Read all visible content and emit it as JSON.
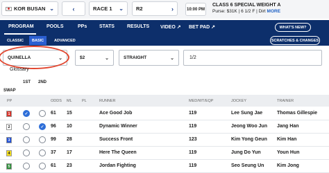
{
  "header": {
    "track": "KOR BUSAN",
    "race": "RACE 1",
    "r_label": "R2",
    "time": "10:00 PM",
    "race_class": "CLASS 6 SPECIAL WEIGHT A",
    "details": "Purse: $31K  |  6 1/2 F  |  Dirt",
    "more": "MORE"
  },
  "nav": {
    "tabs": [
      "PROGRAM",
      "POOLS",
      "PPs",
      "STATS",
      "RESULTS",
      "VIDEO ↗",
      "BET PAD ↗"
    ],
    "whats_new": "WHAT'S NEW?"
  },
  "subnav": {
    "tabs": [
      "CLASSIC",
      "BASIC",
      "ADVANCED"
    ],
    "scratches": "SCRATCHES & CHANGES"
  },
  "filters": {
    "bet_type": "QUINELLA",
    "amount": "$2",
    "modifier": "STRAIGHT",
    "selection": "1/2",
    "glossary": "Glossary"
  },
  "columns": {
    "first": "1ST",
    "second": "2ND",
    "swap": "SWAP",
    "pp": "PP",
    "odds": "ODDS",
    "ml": "ML",
    "pl": "PL",
    "runner": "RUNNER",
    "med_wt_eqp": "MED/WT/EQP",
    "jockey": "JOCKEY",
    "trainer": "TRAINER"
  },
  "colors": {
    "nav_bg": "#0d2f6b",
    "accent": "#2b5fd1",
    "radio_on": "#2f6fd8",
    "highlight": "#e2462f"
  },
  "runners": [
    {
      "pp": "1",
      "pp_bg": "#d9342b",
      "pp_fg": "#ffffff",
      "first": true,
      "second": false,
      "odds": "61",
      "ml": "15",
      "name": "Ace Good Job",
      "wt": "119",
      "jockey": "Lee Sung Jae",
      "trainer": "Thomas Gillespie"
    },
    {
      "pp": "2",
      "pp_bg": "#ffffff",
      "pp_fg": "#1a1a1a",
      "first": false,
      "second": true,
      "odds": "96",
      "ml": "10",
      "name": "Dynamic Winner",
      "wt": "119",
      "jockey": "Jeong Woo Jun",
      "trainer": "Jang Han"
    },
    {
      "pp": "3",
      "pp_bg": "#1f4fd6",
      "pp_fg": "#ffffff",
      "first": false,
      "second": false,
      "odds": "99",
      "ml": "28",
      "name": "Success Front",
      "wt": "123",
      "jockey": "Kim Yong Geun",
      "trainer": "Kim Han"
    },
    {
      "pp": "4",
      "pp_bg": "#f4df1e",
      "pp_fg": "#1a1a1a",
      "first": false,
      "second": false,
      "odds": "37",
      "ml": "17",
      "name": "Here The Queen",
      "wt": "119",
      "jockey": "Jung Do Yun",
      "trainer": "Youn Hun"
    },
    {
      "pp": "5",
      "pp_bg": "#2f8f3a",
      "pp_fg": "#ffffff",
      "first": false,
      "second": false,
      "odds": "61",
      "ml": "23",
      "name": "Jordan Fighting",
      "wt": "119",
      "jockey": "Seo Seung Un",
      "trainer": "Kim Jong"
    }
  ]
}
